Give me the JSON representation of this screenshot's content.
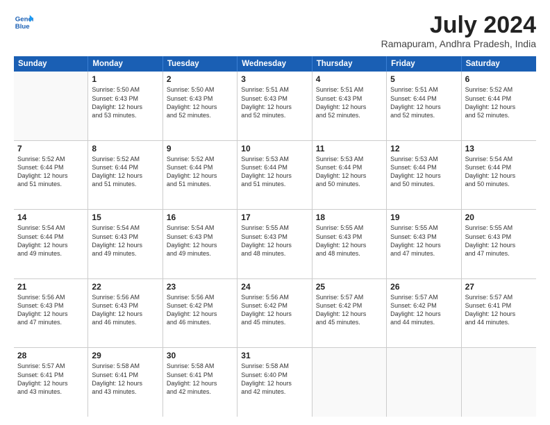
{
  "header": {
    "logo_line1": "General",
    "logo_line2": "Blue",
    "title": "July 2024",
    "subtitle": "Ramapuram, Andhra Pradesh, India"
  },
  "days": [
    "Sunday",
    "Monday",
    "Tuesday",
    "Wednesday",
    "Thursday",
    "Friday",
    "Saturday"
  ],
  "weeks": [
    [
      {
        "day": "",
        "info": ""
      },
      {
        "day": "1",
        "info": "Sunrise: 5:50 AM\nSunset: 6:43 PM\nDaylight: 12 hours\nand 53 minutes."
      },
      {
        "day": "2",
        "info": "Sunrise: 5:50 AM\nSunset: 6:43 PM\nDaylight: 12 hours\nand 52 minutes."
      },
      {
        "day": "3",
        "info": "Sunrise: 5:51 AM\nSunset: 6:43 PM\nDaylight: 12 hours\nand 52 minutes."
      },
      {
        "day": "4",
        "info": "Sunrise: 5:51 AM\nSunset: 6:43 PM\nDaylight: 12 hours\nand 52 minutes."
      },
      {
        "day": "5",
        "info": "Sunrise: 5:51 AM\nSunset: 6:44 PM\nDaylight: 12 hours\nand 52 minutes."
      },
      {
        "day": "6",
        "info": "Sunrise: 5:52 AM\nSunset: 6:44 PM\nDaylight: 12 hours\nand 52 minutes."
      }
    ],
    [
      {
        "day": "7",
        "info": "Sunrise: 5:52 AM\nSunset: 6:44 PM\nDaylight: 12 hours\nand 51 minutes."
      },
      {
        "day": "8",
        "info": "Sunrise: 5:52 AM\nSunset: 6:44 PM\nDaylight: 12 hours\nand 51 minutes."
      },
      {
        "day": "9",
        "info": "Sunrise: 5:52 AM\nSunset: 6:44 PM\nDaylight: 12 hours\nand 51 minutes."
      },
      {
        "day": "10",
        "info": "Sunrise: 5:53 AM\nSunset: 6:44 PM\nDaylight: 12 hours\nand 51 minutes."
      },
      {
        "day": "11",
        "info": "Sunrise: 5:53 AM\nSunset: 6:44 PM\nDaylight: 12 hours\nand 50 minutes."
      },
      {
        "day": "12",
        "info": "Sunrise: 5:53 AM\nSunset: 6:44 PM\nDaylight: 12 hours\nand 50 minutes."
      },
      {
        "day": "13",
        "info": "Sunrise: 5:54 AM\nSunset: 6:44 PM\nDaylight: 12 hours\nand 50 minutes."
      }
    ],
    [
      {
        "day": "14",
        "info": "Sunrise: 5:54 AM\nSunset: 6:44 PM\nDaylight: 12 hours\nand 49 minutes."
      },
      {
        "day": "15",
        "info": "Sunrise: 5:54 AM\nSunset: 6:43 PM\nDaylight: 12 hours\nand 49 minutes."
      },
      {
        "day": "16",
        "info": "Sunrise: 5:54 AM\nSunset: 6:43 PM\nDaylight: 12 hours\nand 49 minutes."
      },
      {
        "day": "17",
        "info": "Sunrise: 5:55 AM\nSunset: 6:43 PM\nDaylight: 12 hours\nand 48 minutes."
      },
      {
        "day": "18",
        "info": "Sunrise: 5:55 AM\nSunset: 6:43 PM\nDaylight: 12 hours\nand 48 minutes."
      },
      {
        "day": "19",
        "info": "Sunrise: 5:55 AM\nSunset: 6:43 PM\nDaylight: 12 hours\nand 47 minutes."
      },
      {
        "day": "20",
        "info": "Sunrise: 5:55 AM\nSunset: 6:43 PM\nDaylight: 12 hours\nand 47 minutes."
      }
    ],
    [
      {
        "day": "21",
        "info": "Sunrise: 5:56 AM\nSunset: 6:43 PM\nDaylight: 12 hours\nand 47 minutes."
      },
      {
        "day": "22",
        "info": "Sunrise: 5:56 AM\nSunset: 6:43 PM\nDaylight: 12 hours\nand 46 minutes."
      },
      {
        "day": "23",
        "info": "Sunrise: 5:56 AM\nSunset: 6:42 PM\nDaylight: 12 hours\nand 46 minutes."
      },
      {
        "day": "24",
        "info": "Sunrise: 5:56 AM\nSunset: 6:42 PM\nDaylight: 12 hours\nand 45 minutes."
      },
      {
        "day": "25",
        "info": "Sunrise: 5:57 AM\nSunset: 6:42 PM\nDaylight: 12 hours\nand 45 minutes."
      },
      {
        "day": "26",
        "info": "Sunrise: 5:57 AM\nSunset: 6:42 PM\nDaylight: 12 hours\nand 44 minutes."
      },
      {
        "day": "27",
        "info": "Sunrise: 5:57 AM\nSunset: 6:41 PM\nDaylight: 12 hours\nand 44 minutes."
      }
    ],
    [
      {
        "day": "28",
        "info": "Sunrise: 5:57 AM\nSunset: 6:41 PM\nDaylight: 12 hours\nand 43 minutes."
      },
      {
        "day": "29",
        "info": "Sunrise: 5:58 AM\nSunset: 6:41 PM\nDaylight: 12 hours\nand 43 minutes."
      },
      {
        "day": "30",
        "info": "Sunrise: 5:58 AM\nSunset: 6:41 PM\nDaylight: 12 hours\nand 42 minutes."
      },
      {
        "day": "31",
        "info": "Sunrise: 5:58 AM\nSunset: 6:40 PM\nDaylight: 12 hours\nand 42 minutes."
      },
      {
        "day": "",
        "info": ""
      },
      {
        "day": "",
        "info": ""
      },
      {
        "day": "",
        "info": ""
      }
    ]
  ]
}
